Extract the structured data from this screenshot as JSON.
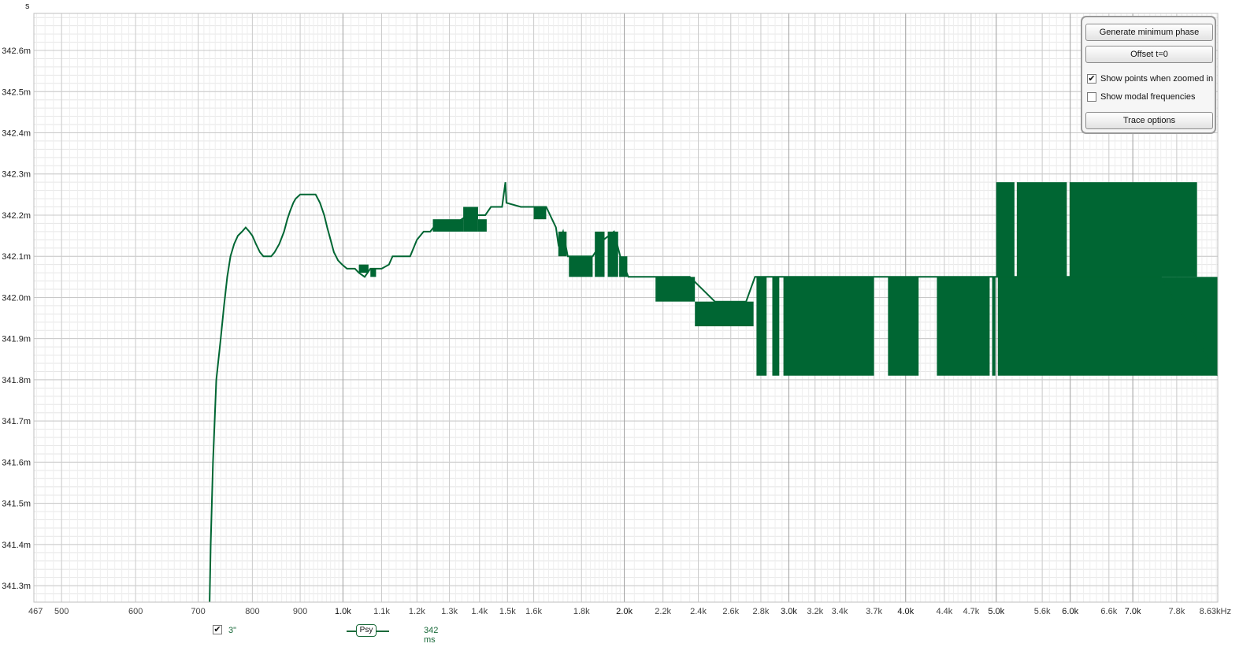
{
  "chart_data": {
    "type": "line",
    "y_unit": "s",
    "x_scale": "log",
    "xlim": [
      467,
      8630
    ],
    "ylim": [
      0.34126,
      0.34269
    ],
    "y_ticks": [
      {
        "v": 0.3426,
        "label": "342.6m"
      },
      {
        "v": 0.3425,
        "label": "342.5m"
      },
      {
        "v": 0.3424,
        "label": "342.4m"
      },
      {
        "v": 0.3423,
        "label": "342.3m"
      },
      {
        "v": 0.3422,
        "label": "342.2m"
      },
      {
        "v": 0.3421,
        "label": "342.1m"
      },
      {
        "v": 0.342,
        "label": "342.0m"
      },
      {
        "v": 0.3419,
        "label": "341.9m"
      },
      {
        "v": 0.3418,
        "label": "341.8m"
      },
      {
        "v": 0.3417,
        "label": "341.7m"
      },
      {
        "v": 0.3416,
        "label": "341.6m"
      },
      {
        "v": 0.3415,
        "label": "341.5m"
      },
      {
        "v": 0.3414,
        "label": "341.4m"
      },
      {
        "v": 0.3413,
        "label": "341.3m"
      }
    ],
    "x_ticks": [
      {
        "v": 467,
        "label": "467"
      },
      {
        "v": 500,
        "label": "500"
      },
      {
        "v": 600,
        "label": "600"
      },
      {
        "v": 700,
        "label": "700"
      },
      {
        "v": 800,
        "label": "800"
      },
      {
        "v": 900,
        "label": "900"
      },
      {
        "v": 1000,
        "label": "1.0k",
        "major": true
      },
      {
        "v": 1100,
        "label": "1.1k"
      },
      {
        "v": 1200,
        "label": "1.2k"
      },
      {
        "v": 1300,
        "label": "1.3k"
      },
      {
        "v": 1400,
        "label": "1.4k"
      },
      {
        "v": 1500,
        "label": "1.5k"
      },
      {
        "v": 1600,
        "label": "1.6k"
      },
      {
        "v": 1800,
        "label": "1.8k"
      },
      {
        "v": 2000,
        "label": "2.0k",
        "major": true
      },
      {
        "v": 2200,
        "label": "2.2k"
      },
      {
        "v": 2400,
        "label": "2.4k"
      },
      {
        "v": 2600,
        "label": "2.6k"
      },
      {
        "v": 2800,
        "label": "2.8k"
      },
      {
        "v": 3000,
        "label": "3.0k",
        "major": true
      },
      {
        "v": 3200,
        "label": "3.2k"
      },
      {
        "v": 3400,
        "label": "3.4k"
      },
      {
        "v": 3700,
        "label": "3.7k"
      },
      {
        "v": 4000,
        "label": "4.0k",
        "major": true
      },
      {
        "v": 4400,
        "label": "4.4k"
      },
      {
        "v": 4700,
        "label": "4.7k"
      },
      {
        "v": 5000,
        "label": "5.0k",
        "major": true
      },
      {
        "v": 5600,
        "label": "5.6k"
      },
      {
        "v": 6000,
        "label": "6.0k",
        "major": true
      },
      {
        "v": 6600,
        "label": "6.6k"
      },
      {
        "v": 7000,
        "label": "7.0k",
        "major": true
      },
      {
        "v": 7800,
        "label": "7.8k"
      },
      {
        "v": 8630,
        "label": "8.63kHz"
      }
    ],
    "series": [
      {
        "color": "#006633",
        "line": [
          [
            720,
            0.34126
          ],
          [
            722,
            0.3414
          ],
          [
            726,
            0.3416
          ],
          [
            732,
            0.3418
          ],
          [
            740,
            0.3419
          ],
          [
            746,
            0.34198
          ],
          [
            752,
            0.34205
          ],
          [
            758,
            0.3421
          ],
          [
            765,
            0.34213
          ],
          [
            772,
            0.34215
          ],
          [
            780,
            0.34216
          ],
          [
            787,
            0.34217
          ],
          [
            794,
            0.34216
          ],
          [
            800,
            0.34215
          ],
          [
            807,
            0.34213
          ],
          [
            815,
            0.34211
          ],
          [
            822,
            0.3421
          ],
          [
            838,
            0.3421
          ],
          [
            845,
            0.34211
          ],
          [
            855,
            0.34213
          ],
          [
            865,
            0.34216
          ],
          [
            872,
            0.34219
          ],
          [
            878,
            0.34221
          ],
          [
            885,
            0.34223
          ],
          [
            890,
            0.34224
          ],
          [
            900,
            0.34225
          ],
          [
            935,
            0.34225
          ],
          [
            945,
            0.34223
          ],
          [
            955,
            0.3422
          ],
          [
            962,
            0.34217
          ],
          [
            970,
            0.34214
          ],
          [
            978,
            0.34211
          ],
          [
            988,
            0.34209
          ],
          [
            998,
            0.34208
          ],
          [
            1010,
            0.34207
          ],
          [
            1030,
            0.34207
          ],
          [
            1040,
            0.34206
          ],
          [
            1055,
            0.34205
          ],
          [
            1070,
            0.34207
          ],
          [
            1100,
            0.34207
          ],
          [
            1120,
            0.34208
          ],
          [
            1130,
            0.3421
          ],
          [
            1180,
            0.3421
          ],
          [
            1200,
            0.34214
          ],
          [
            1220,
            0.34216
          ],
          [
            1240,
            0.34216
          ],
          [
            1260,
            0.34218
          ],
          [
            1320,
            0.34218
          ],
          [
            1360,
            0.3422
          ],
          [
            1420,
            0.3422
          ],
          [
            1440,
            0.34222
          ],
          [
            1480,
            0.34222
          ],
          [
            1492,
            0.34228
          ],
          [
            1496,
            0.34223
          ],
          [
            1550,
            0.34222
          ],
          [
            1610,
            0.34222
          ],
          [
            1650,
            0.34222
          ],
          [
            1690,
            0.34217
          ],
          [
            1700,
            0.34213
          ],
          [
            1720,
            0.34216
          ],
          [
            1740,
            0.3421
          ],
          [
            1790,
            0.3421
          ],
          [
            1850,
            0.3421
          ],
          [
            1900,
            0.34214
          ],
          [
            1950,
            0.34216
          ],
          [
            1980,
            0.3421
          ],
          [
            2020,
            0.34205
          ],
          [
            2050,
            0.34205
          ],
          [
            2200,
            0.34205
          ],
          [
            2350,
            0.34205
          ],
          [
            2500,
            0.34199
          ],
          [
            2700,
            0.34199
          ],
          [
            2760,
            0.34205
          ],
          [
            2900,
            0.34205
          ],
          [
            3500,
            0.34205
          ],
          [
            3800,
            0.34205
          ],
          [
            4400,
            0.34205
          ],
          [
            4900,
            0.34205
          ],
          [
            5100,
            0.34205
          ],
          [
            7500,
            0.34205
          ],
          [
            8630,
            0.34181
          ]
        ],
        "bands": [
          [
            1040,
            1065,
            0.34206,
            0.34208
          ],
          [
            1070,
            1085,
            0.34205,
            0.34207
          ],
          [
            1248,
            1345,
            0.34216,
            0.34219
          ],
          [
            1345,
            1395,
            0.34216,
            0.34222
          ],
          [
            1395,
            1425,
            0.34216,
            0.34219
          ],
          [
            1600,
            1650,
            0.34219,
            0.34222
          ],
          [
            1700,
            1735,
            0.3421,
            0.34216
          ],
          [
            1745,
            1850,
            0.34205,
            0.3421
          ],
          [
            1860,
            1905,
            0.34205,
            0.34216
          ],
          [
            1920,
            1970,
            0.34205,
            0.34216
          ],
          [
            1975,
            2015,
            0.34205,
            0.3421
          ],
          [
            2160,
            2380,
            0.34199,
            0.34205
          ],
          [
            2380,
            2750,
            0.34193,
            0.34199
          ],
          [
            2770,
            2840,
            0.34181,
            0.34205
          ],
          [
            2880,
            2930,
            0.34181,
            0.34205
          ],
          [
            2960,
            3700,
            0.34181,
            0.34205
          ],
          [
            3830,
            4130,
            0.34181,
            0.34205
          ],
          [
            4320,
            4920,
            0.34181,
            0.34205
          ],
          [
            4950,
            4990,
            0.34181,
            0.34205
          ],
          [
            5020,
            8630,
            0.34181,
            0.34205
          ],
          [
            5000,
            5230,
            0.34205,
            0.34228
          ],
          [
            5260,
            5950,
            0.34205,
            0.34228
          ],
          [
            5990,
            8200,
            0.34205,
            0.34228
          ]
        ]
      }
    ]
  },
  "controls": {
    "generate_min_phase": "Generate minimum phase",
    "offset": "Offset t=0",
    "show_points": "Show points when zoomed in",
    "show_points_checked": "✔",
    "show_modal": "Show modal frequencies",
    "trace_options": "Trace options"
  },
  "legend": {
    "checked": "✔",
    "name": "3\"",
    "tag": "Psy",
    "value": "342 ms"
  }
}
